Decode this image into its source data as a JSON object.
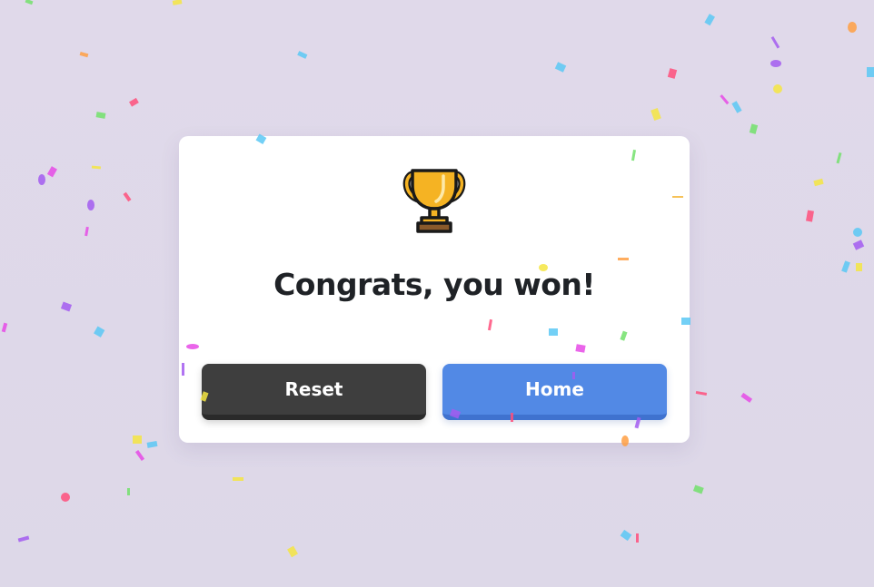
{
  "dialog": {
    "title": "Congrats, you won!",
    "icon": "trophy-icon",
    "buttons": {
      "reset_label": "Reset",
      "home_label": "Home"
    }
  },
  "colors": {
    "background": "#e0d9ea",
    "card": "#ffffff",
    "title_text": "#1f2226",
    "reset_button": "#3e3e3e",
    "home_button": "#5289e5",
    "trophy_gold": "#f5b323",
    "trophy_base": "#8a5a2b",
    "confetti_palette": [
      "#f4e542",
      "#5bc8f5",
      "#a35cf0",
      "#ff4f7b",
      "#72e06b",
      "#ff9f43",
      "#e64ae6"
    ]
  }
}
